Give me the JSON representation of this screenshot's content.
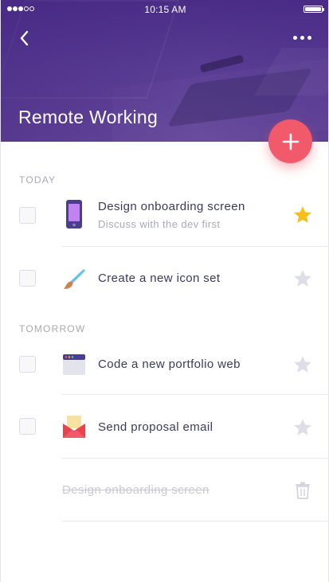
{
  "status_bar": {
    "time": "10:15 AM",
    "signal_bars_filled": 3,
    "signal_bars_total": 5
  },
  "header": {
    "title": "Remote Working",
    "back_icon": "chevron-left-icon",
    "more_icon": "more-horizontal-icon"
  },
  "fab": {
    "icon": "plus-icon",
    "color": "#f05a6a"
  },
  "sections": [
    {
      "label": "TODAY"
    },
    {
      "label": "TOMORROW"
    }
  ],
  "tasks": [
    {
      "title": "Design onboarding screen",
      "subtitle": "Discuss with the dev first",
      "icon": "phone-icon",
      "starred": true
    },
    {
      "title": "Create a new icon set",
      "icon": "paintbrush-icon",
      "starred": false
    },
    {
      "title": "Code a new portfolio web",
      "icon": "browser-window-icon",
      "starred": false
    },
    {
      "title": "Send proposal email",
      "icon": "envelope-icon",
      "starred": false
    }
  ],
  "completed_task": {
    "title": "Design onboarding screen",
    "icon": "trash-icon"
  },
  "colors": {
    "header": "#5b3f96",
    "accent": "#f05a6a",
    "star_active": "#f7bf1a",
    "star_inactive": "#dedee6",
    "text": "#3b3a5e",
    "muted": "#a9a9bd"
  }
}
